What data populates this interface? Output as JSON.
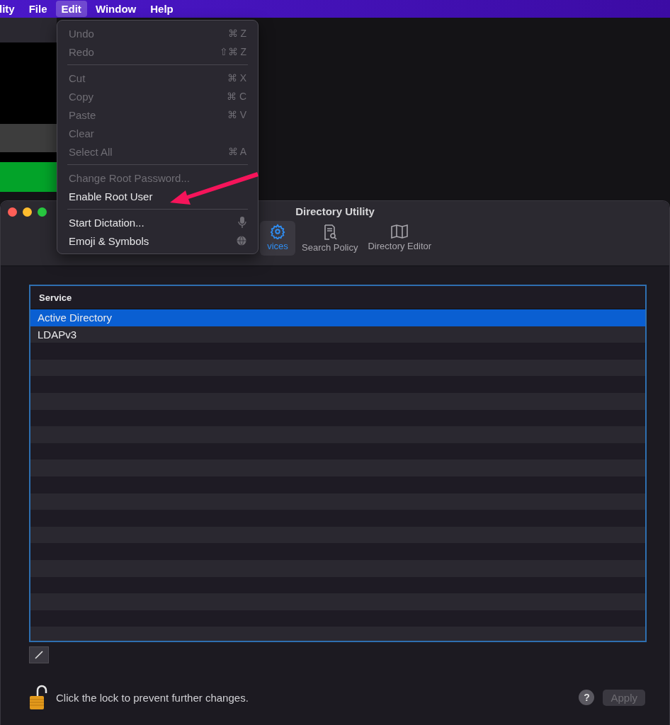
{
  "menu_bar": {
    "items": [
      {
        "label": "lity",
        "selected": false
      },
      {
        "label": "File",
        "selected": false
      },
      {
        "label": "Edit",
        "selected": true
      },
      {
        "label": "Window",
        "selected": false
      },
      {
        "label": "Help",
        "selected": false
      }
    ]
  },
  "edit_menu": {
    "groups": [
      [
        {
          "label": "Undo",
          "shortcut": "⌘ Z",
          "disabled": true
        },
        {
          "label": "Redo",
          "shortcut": "⇧⌘ Z",
          "disabled": true
        }
      ],
      [
        {
          "label": "Cut",
          "shortcut": "⌘ X",
          "disabled": true
        },
        {
          "label": "Copy",
          "shortcut": "⌘ C",
          "disabled": true
        },
        {
          "label": "Paste",
          "shortcut": "⌘ V",
          "disabled": true
        },
        {
          "label": "Clear",
          "disabled": true
        },
        {
          "label": "Select All",
          "shortcut": "⌘ A",
          "disabled": true
        }
      ],
      [
        {
          "label": "Change Root Password...",
          "disabled": true
        },
        {
          "label": "Enable Root User",
          "disabled": false
        }
      ],
      [
        {
          "label": "Start Dictation...",
          "disabled": false,
          "kind": "microphone"
        },
        {
          "label": "Emoji & Symbols",
          "disabled": false,
          "kind": "globe"
        }
      ]
    ]
  },
  "window": {
    "title": "Directory Utility",
    "tabs": [
      {
        "label": "vices",
        "selected": true
      },
      {
        "label": "Search Policy",
        "selected": false
      },
      {
        "label": "Directory Editor",
        "selected": false
      }
    ],
    "table": {
      "columns": [
        "Service"
      ],
      "rows": [
        {
          "service": "Active Directory",
          "selected": true
        },
        {
          "service": "LDAPv3",
          "selected": false
        }
      ]
    },
    "lock_message": "Click the lock to prevent further changes.",
    "help_button": "?",
    "apply_button": {
      "label": "Apply",
      "disabled": true
    }
  }
}
